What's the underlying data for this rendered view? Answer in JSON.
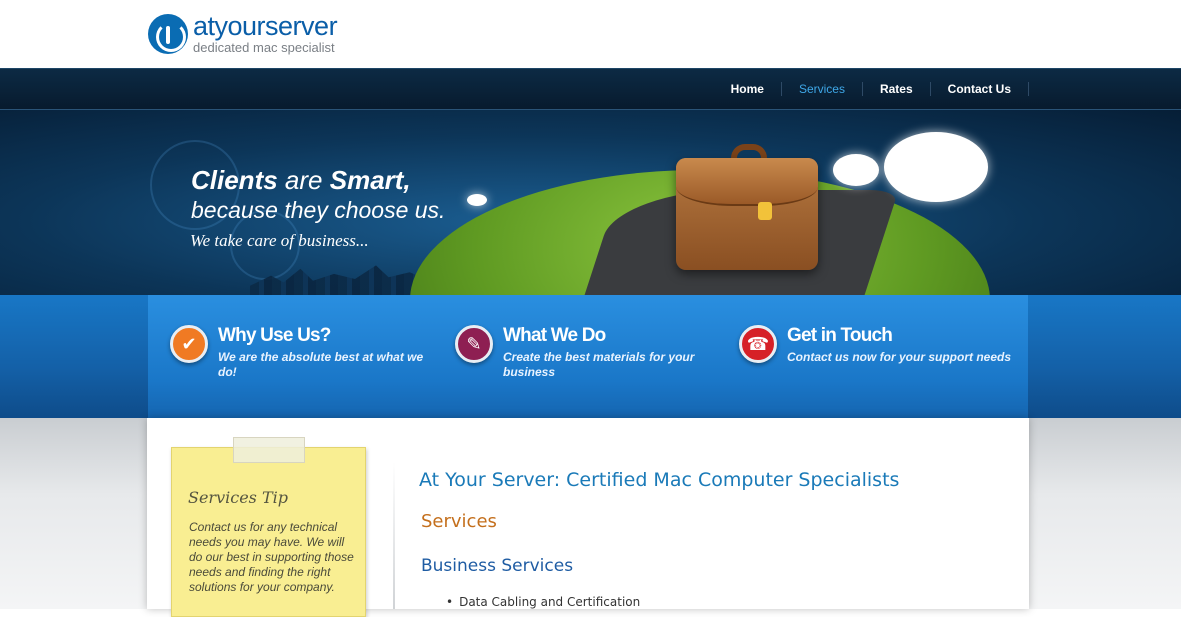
{
  "logo": {
    "title": "atyourserver",
    "subtitle": "dedicated mac specialist"
  },
  "nav": {
    "items": [
      "Home",
      "Services",
      "Rates",
      "Contact Us"
    ],
    "active": "Services"
  },
  "hero": {
    "title_bold_1": "Clients",
    "title_mid": "are",
    "title_bold_2": "Smart,",
    "subtitle": "because they choose us.",
    "tagline": "We take care of business..."
  },
  "features": [
    {
      "title": "Why Use Us?",
      "desc": "We are the absolute best at what we do!",
      "icon": "checkmark-icon",
      "color": "#f07a23"
    },
    {
      "title": "What We Do",
      "desc": "Create the best materials for your business",
      "icon": "pencil-icon",
      "color": "#8e1f52"
    },
    {
      "title": "Get in Touch",
      "desc": "Contact us now for your support needs",
      "icon": "phone-icon",
      "color": "#d62027"
    }
  ],
  "note": {
    "title": "Services Tip",
    "text": "Contact us for any technical needs you may have.  We will do our best in supporting those needs and finding the right solutions for your company."
  },
  "main": {
    "page_title": "At Your Server: Certified Mac Computer Specialists",
    "section_title": "Services",
    "sub_title": "Business Services",
    "bullets": [
      "Data Cabling and Certification"
    ]
  },
  "colors": {
    "brand": "#0a5ea8",
    "nav_active": "#3fa8e8",
    "accent_orange": "#c46f1c",
    "note_yellow": "#f9ee92"
  }
}
